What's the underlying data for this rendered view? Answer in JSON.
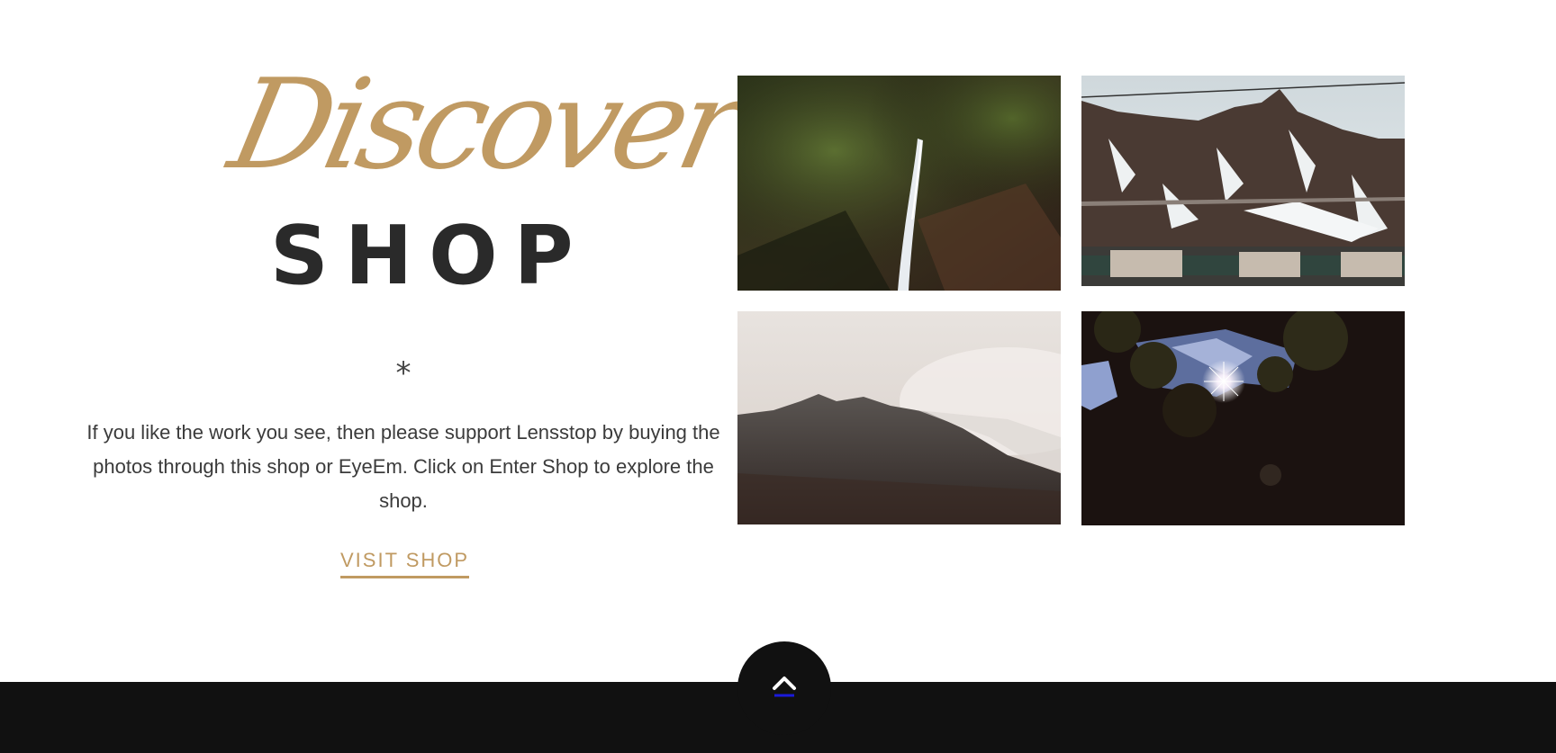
{
  "hero": {
    "script_title": "Discover",
    "title": "SHOP",
    "divider": "*",
    "description": "If you like the work you see, then please support Lensstop by buying the photos through this shop or EyeEm. Click on Enter Shop to explore the shop.",
    "cta_label": "VISIT SHOP"
  },
  "gallery": {
    "photos": [
      {
        "subject": "waterfall-forest"
      },
      {
        "subject": "snowy-mountain-road"
      },
      {
        "subject": "misty-mountain-peak"
      },
      {
        "subject": "sun-through-trees"
      }
    ]
  },
  "footer": {
    "back_to_top_icon": "chevron-up-icon"
  },
  "colors": {
    "accent": "#c09a62",
    "heading": "#2a2a2a",
    "body_text": "#3b3b3b",
    "footer_bg": "#111111"
  }
}
